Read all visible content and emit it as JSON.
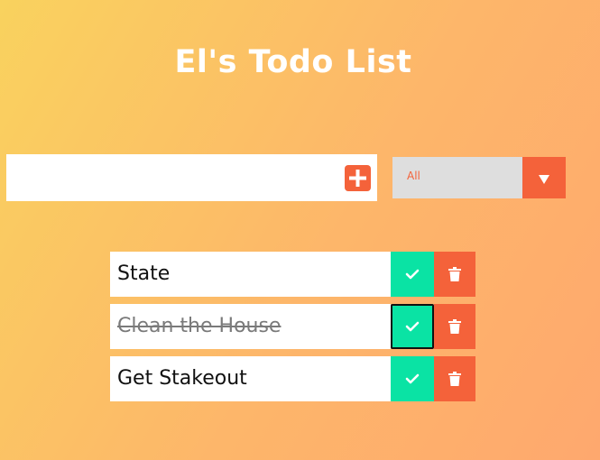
{
  "header": {
    "title": "El's Todo List"
  },
  "form": {
    "input_value": "",
    "add_icon": "plus-square-icon",
    "filter_selected": "All",
    "filter_icon": "caret-down-icon"
  },
  "todos": [
    {
      "text": "State",
      "completed": false,
      "check_icon": "check-icon",
      "delete_icon": "trash-icon"
    },
    {
      "text": "Clean the House",
      "completed": true,
      "check_icon": "check-icon",
      "delete_icon": "trash-icon"
    },
    {
      "text": "Get Stakeout",
      "completed": false,
      "check_icon": "check-icon",
      "delete_icon": "trash-icon"
    }
  ],
  "colors": {
    "accent": "#f4623a",
    "complete": "#0ae3a4",
    "select_bg": "#dedede",
    "gradient_start": "#f9d25e",
    "gradient_end": "#fea86e"
  }
}
